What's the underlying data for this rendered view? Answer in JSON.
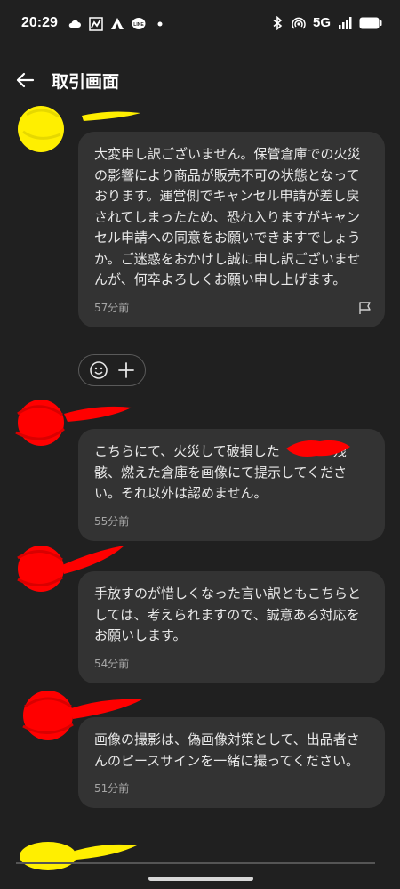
{
  "status_bar": {
    "time": "20:29",
    "network": "5G",
    "left_icons": [
      "cloud-icon",
      "chart-icon",
      "tent-icon",
      "line-app-icon",
      "dot-icon"
    ],
    "right_icons": [
      "bluetooth-icon",
      "hotspot-icon",
      "signal-icon",
      "battery-icon"
    ]
  },
  "header": {
    "title": "取引画面"
  },
  "messages": [
    {
      "text": "大変申し訳ございません。保管倉庫での火災の影響により商品が販売不可の状態となっております。運営側でキャンセル申請が差し戻されてしまったため、恐れ入りますがキャンセル申請への同意をお願いできますでしょうか。ご迷惑をおかけし誠に申し訳ございませんが、何卒よろしくお願い申し上げます。",
      "time": "57分前",
      "avatar_color": "#ffef00"
    },
    {
      "text": "こちらにて、火災して破損した　　　　残骸、燃えた倉庫を画像にて提示してください。それ以外は認めません。",
      "time": "55分前",
      "avatar_color": "#ff0000"
    },
    {
      "text": "手放すのが惜しくなった言い訳ともこちらとしては、考えられますので、誠意ある対応をお願いします。",
      "time": "54分前",
      "avatar_color": "#ff0000"
    },
    {
      "text": "画像の撮影は、偽画像対策として、出品者さんのピースサインを一緒に撮ってください。",
      "time": "51分前",
      "avatar_color": "#ff0000"
    }
  ],
  "reactions": {
    "icons": [
      "emoji-icon",
      "plus-icon"
    ]
  },
  "colors": {
    "background": "#202020",
    "bubble": "#333333",
    "text": "#e9e9e9",
    "muted": "#a5a5a5"
  }
}
